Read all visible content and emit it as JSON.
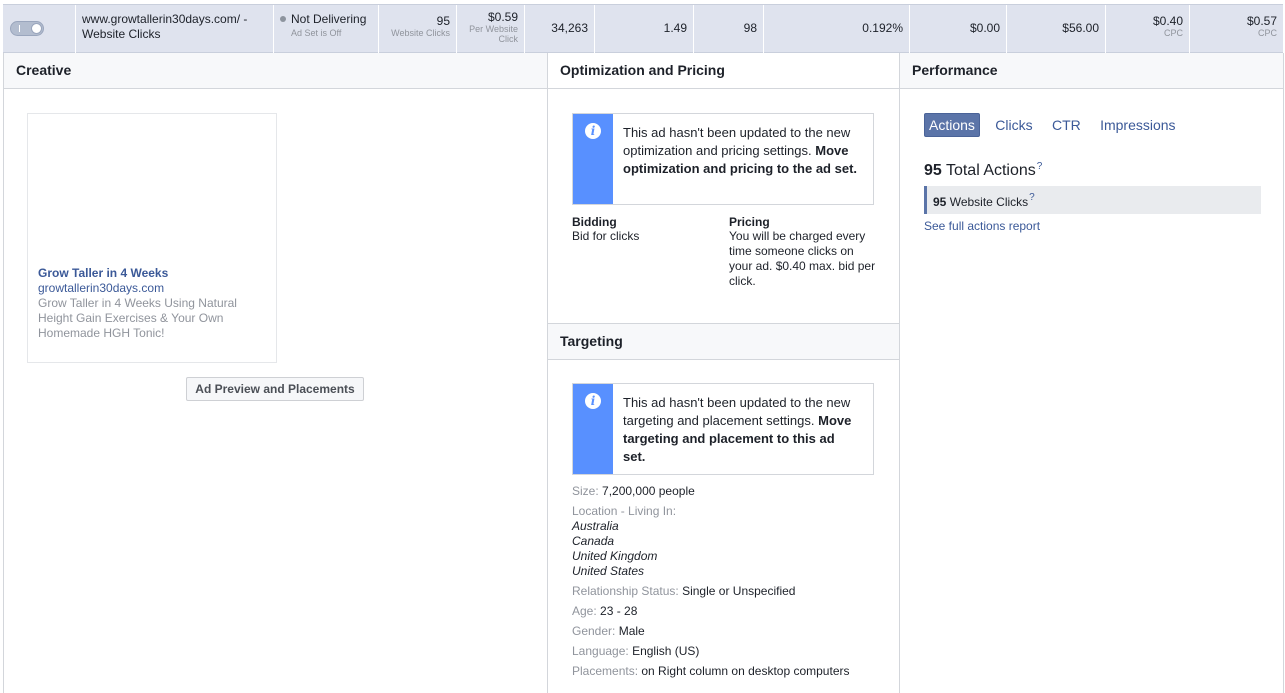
{
  "row": {
    "ad_name_line1": "www.growtallerin30days.com/ -",
    "ad_name_line2": "Website Clicks",
    "delivery_status": "Not Delivering",
    "delivery_sub": "Ad Set is Off",
    "results": "95",
    "results_label": "Website Clicks",
    "cost_per_result": "$0.59",
    "cost_label_line1": "Per Website",
    "cost_label_line2": "Click",
    "reach": "34,263",
    "frequency": "1.49",
    "clicks": "98",
    "ctr": "0.192%",
    "budget": "$0.00",
    "amount_spent": "$56.00",
    "cpc1": "$0.40",
    "cpc1_label": "CPC",
    "cpc2": "$0.57",
    "cpc2_label": "CPC"
  },
  "creative": {
    "header": "Creative",
    "ad_title": "Grow Taller in 4 Weeks",
    "ad_url": "growtallerin30days.com",
    "ad_desc": "Grow Taller in 4 Weeks Using Natural Height Gain Exercises & Your Own Homemade HGH Tonic!",
    "preview_button": "Ad Preview and Placements"
  },
  "optimization": {
    "header": "Optimization and Pricing",
    "notice_text": "This ad hasn't been updated to the new optimization and pricing settings.",
    "notice_bold": "Move optimization and pricing to the ad set.",
    "bidding_label": "Bidding",
    "bidding_value": "Bid for clicks",
    "pricing_label": "Pricing",
    "pricing_value": "You will be charged every time someone clicks on your ad. $0.40 max. bid per click."
  },
  "targeting": {
    "header": "Targeting",
    "notice_text": "This ad hasn't been updated to the new targeting and placement settings.",
    "notice_bold": "Move targeting and placement to this ad set.",
    "size_label": "Size:",
    "size_value": "7,200,000 people",
    "location_label": "Location - Living In:",
    "locations": [
      "Australia",
      "Canada",
      "United Kingdom",
      "United States"
    ],
    "relationship_label": "Relationship Status:",
    "relationship_value": "Single or Unspecified",
    "age_label": "Age:",
    "age_value": "23 - 28",
    "gender_label": "Gender:",
    "gender_value": "Male",
    "language_label": "Language:",
    "language_value": "English (US)",
    "placements_label": "Placements:",
    "placements_value": "on Right column on desktop computers"
  },
  "performance": {
    "header": "Performance",
    "tabs": [
      "Actions",
      "Clicks",
      "CTR",
      "Impressions"
    ],
    "total_number": "95",
    "total_label": "Total Actions",
    "help_mark": "?",
    "action_number": "95",
    "action_label": "Website Clicks",
    "full_report": "See full actions report"
  },
  "colors": {
    "row_bg": "#dfe3ee",
    "link": "#3b5998",
    "notice_accent": "#5890ff",
    "active_tab": "#5b74a8"
  }
}
